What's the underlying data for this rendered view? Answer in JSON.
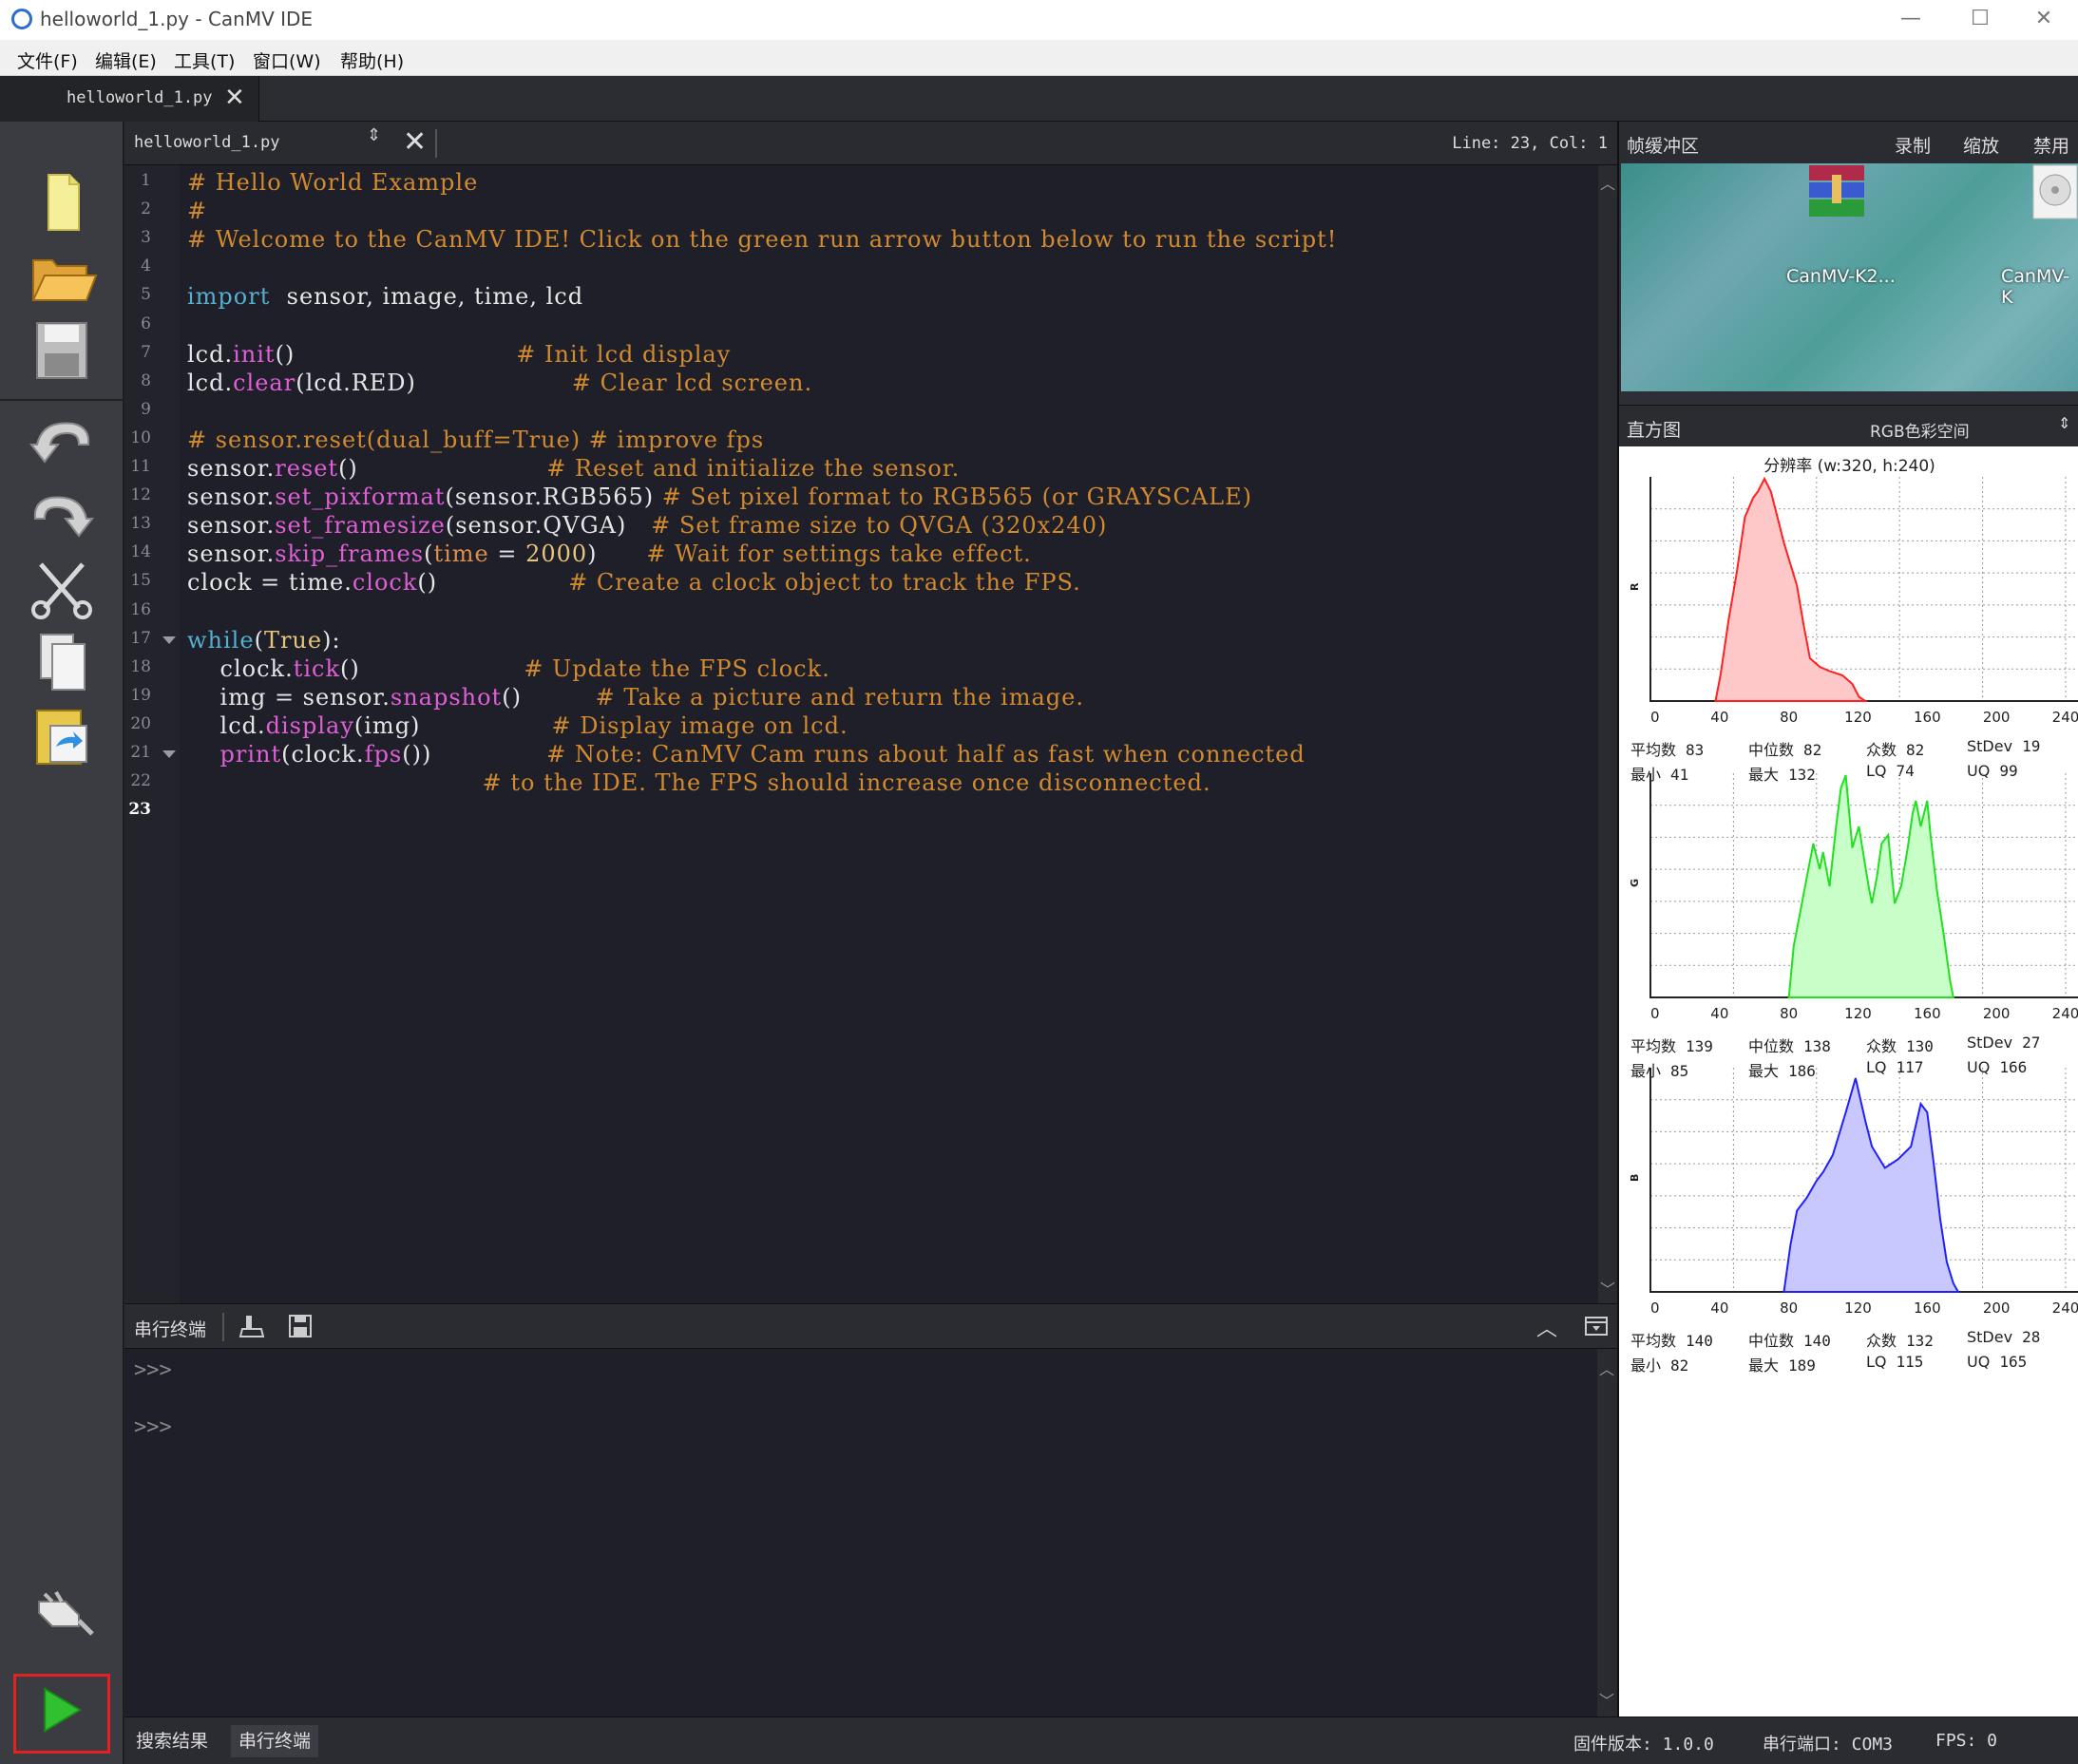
{
  "window": {
    "title": "helloworld_1.py - CanMV IDE",
    "minimize": "—",
    "maximize": "☐",
    "close": "✕"
  },
  "menu": [
    "文件(F)",
    "编辑(E)",
    "工具(T)",
    "窗口(W)",
    "帮助(H)"
  ],
  "file_tab": {
    "label": "helloworld_1.py",
    "close": "✕"
  },
  "toolbar": {
    "icons": [
      "new-file-icon",
      "open-folder-icon",
      "save-icon",
      "undo-icon",
      "redo-icon",
      "cut-icon",
      "copy-icon",
      "paste-icon",
      "connect-icon",
      "run-icon"
    ]
  },
  "editor": {
    "filename": "helloworld_1.py",
    "updown": "⇕",
    "close": "✕",
    "position": "Line: 23, Col: 1",
    "current_line": "23",
    "line_numbers": [
      "1",
      "2",
      "3",
      "4",
      "5",
      "6",
      "7",
      "8",
      "9",
      "10",
      "11",
      "12",
      "13",
      "14",
      "15",
      "16",
      "17",
      "18",
      "19",
      "20",
      "21",
      "22",
      "23"
    ],
    "lines": [
      [
        [
          "c-com",
          "# Hello World Example"
        ]
      ],
      [
        [
          "c-com",
          "#"
        ]
      ],
      [
        [
          "c-com",
          "# Welcome to the CanMV IDE! Click on the green run arrow button below to run the script!"
        ]
      ],
      [],
      [
        [
          "c-kw",
          "import"
        ],
        [
          "",
          "  sensor, image, time, lcd"
        ]
      ],
      [],
      [
        [
          "",
          "lcd."
        ],
        [
          "c-fn",
          "init"
        ],
        [
          "",
          "()                           "
        ],
        [
          "c-com",
          "# Init lcd display"
        ]
      ],
      [
        [
          "",
          "lcd."
        ],
        [
          "c-fn",
          "clear"
        ],
        [
          "",
          "(lcd.RED)                   "
        ],
        [
          "c-com",
          "# Clear lcd screen."
        ]
      ],
      [],
      [
        [
          "c-com",
          "# sensor.reset(dual_buff=True) # improve fps"
        ]
      ],
      [
        [
          "",
          "sensor."
        ],
        [
          "c-fn",
          "reset"
        ],
        [
          "",
          "()                       "
        ],
        [
          "c-com",
          "# Reset and initialize the sensor."
        ]
      ],
      [
        [
          "",
          "sensor."
        ],
        [
          "c-fn",
          "set_pixformat"
        ],
        [
          "",
          "(sensor.RGB565) "
        ],
        [
          "c-com",
          "# Set pixel format to RGB565 (or GRAYSCALE)"
        ]
      ],
      [
        [
          "",
          "sensor."
        ],
        [
          "c-fn",
          "set_framesize"
        ],
        [
          "",
          "(sensor.QVGA)   "
        ],
        [
          "c-com",
          "# Set frame size to QVGA (320x240)"
        ]
      ],
      [
        [
          "",
          "sensor."
        ],
        [
          "c-fn",
          "skip_frames"
        ],
        [
          "",
          "("
        ],
        [
          "c-arg",
          "time"
        ],
        [
          "",
          " = "
        ],
        [
          "c-num",
          "2000"
        ],
        [
          "",
          ")      "
        ],
        [
          "c-com",
          "# Wait for settings take effect."
        ]
      ],
      [
        [
          "",
          "clock = time."
        ],
        [
          "c-fn",
          "clock"
        ],
        [
          "",
          "()                "
        ],
        [
          "c-com",
          "# Create a clock object to track the FPS."
        ]
      ],
      [],
      [
        [
          "c-kw",
          "while"
        ],
        [
          "",
          "("
        ],
        [
          "c-num",
          "True"
        ],
        [
          "",
          "):"
        ]
      ],
      [
        [
          "",
          "    clock."
        ],
        [
          "c-fn",
          "tick"
        ],
        [
          "",
          "()                    "
        ],
        [
          "c-com",
          "# Update the FPS clock."
        ]
      ],
      [
        [
          "",
          "    img = sensor."
        ],
        [
          "c-fn",
          "snapshot"
        ],
        [
          "",
          "()         "
        ],
        [
          "c-com",
          "# Take a picture and return the image."
        ]
      ],
      [
        [
          "",
          "    lcd."
        ],
        [
          "c-fn",
          "display"
        ],
        [
          "",
          "(img)                "
        ],
        [
          "c-com",
          "# Display image on lcd."
        ]
      ],
      [
        [
          "",
          "    "
        ],
        [
          "c-fn",
          "print"
        ],
        [
          "",
          "(clock."
        ],
        [
          "c-fn",
          "fps"
        ],
        [
          "",
          "())              "
        ],
        [
          "c-com",
          "# Note: CanMV Cam runs about half as fast when connected"
        ]
      ],
      [
        [
          "",
          "                                    "
        ],
        [
          "c-com",
          "# to the IDE. The FPS should increase once disconnected."
        ]
      ],
      []
    ]
  },
  "terminal": {
    "title": "串行终端",
    "prompts": [
      ">>>",
      ">>>"
    ]
  },
  "statusbar": {
    "tabs": [
      "搜索结果",
      "串行终端"
    ],
    "firmware": "固件版本: 1.0.0",
    "port": "串行端口: COM3",
    "fps": "FPS: 0"
  },
  "framebuffer": {
    "title": "帧缓冲区",
    "record": "录制",
    "zoom": "缩放",
    "disable": "禁用",
    "desktop_labels": [
      "CanMV-K2...",
      "CanMV-K"
    ]
  },
  "histogram": {
    "title": "直方图",
    "colorspace": "RGB色彩空间",
    "resolution": "分辨率 (w:320, h:240)",
    "x_ticks": [
      "0",
      "40",
      "80",
      "120",
      "160",
      "200",
      "240"
    ],
    "channels": [
      {
        "name": "R",
        "color": "#ffc8c8",
        "stroke": "#ff2020",
        "stats": {
          "mean_label": "平均数",
          "mean": "83",
          "median_label": "中位数",
          "median": "82",
          "mode_label": "众数",
          "mode": "82",
          "stdev_label": "StDev",
          "stdev": "19",
          "min_label": "最小",
          "min": "41",
          "max_label": "最大",
          "max": "132",
          "lq_label": "LQ",
          "lq": "74",
          "uq_label": "UQ",
          "uq": "99"
        },
        "points": [
          [
            40,
            0
          ],
          [
            43,
            12
          ],
          [
            48,
            38
          ],
          [
            53,
            60
          ],
          [
            58,
            86
          ],
          [
            63,
            95
          ],
          [
            66,
            98
          ],
          [
            70,
            104
          ],
          [
            74,
            98
          ],
          [
            78,
            86
          ],
          [
            82,
            74
          ],
          [
            86,
            64
          ],
          [
            90,
            54
          ],
          [
            94,
            36
          ],
          [
            98,
            20
          ],
          [
            104,
            16
          ],
          [
            110,
            14
          ],
          [
            118,
            12
          ],
          [
            124,
            8
          ],
          [
            128,
            2
          ],
          [
            132,
            0
          ]
        ]
      },
      {
        "name": "G",
        "color": "#c8ffc8",
        "stroke": "#20e020",
        "stats": {
          "mean_label": "平均数",
          "mean": "139",
          "median_label": "中位数",
          "median": "138",
          "mode_label": "众数",
          "mode": "130",
          "stdev_label": "StDev",
          "stdev": "27",
          "min_label": "最小",
          "min": "85",
          "max_label": "最大",
          "max": "186",
          "lq_label": "LQ",
          "lq": "117",
          "uq_label": "UQ",
          "uq": "166"
        },
        "points": [
          [
            85,
            0
          ],
          [
            88,
            24
          ],
          [
            92,
            40
          ],
          [
            96,
            56
          ],
          [
            100,
            72
          ],
          [
            104,
            60
          ],
          [
            106,
            68
          ],
          [
            110,
            52
          ],
          [
            114,
            80
          ],
          [
            117,
            98
          ],
          [
            120,
            104
          ],
          [
            124,
            70
          ],
          [
            128,
            80
          ],
          [
            131,
            66
          ],
          [
            134,
            52
          ],
          [
            136,
            44
          ],
          [
            139,
            56
          ],
          [
            142,
            72
          ],
          [
            146,
            76
          ],
          [
            148,
            60
          ],
          [
            150,
            44
          ],
          [
            154,
            52
          ],
          [
            158,
            70
          ],
          [
            161,
            86
          ],
          [
            163,
            92
          ],
          [
            166,
            80
          ],
          [
            168,
            86
          ],
          [
            170,
            92
          ],
          [
            172,
            76
          ],
          [
            176,
            50
          ],
          [
            180,
            30
          ],
          [
            184,
            8
          ],
          [
            186,
            0
          ]
        ]
      },
      {
        "name": "B",
        "color": "#c8c8ff",
        "stroke": "#2020ff",
        "stats": {
          "mean_label": "平均数",
          "mean": "140",
          "median_label": "中位数",
          "median": "140",
          "mode_label": "众数",
          "mode": "132",
          "stdev_label": "StDev",
          "stdev": "28",
          "min_label": "最小",
          "min": "82",
          "max_label": "最大",
          "max": "189",
          "lq_label": "LQ",
          "lq": "115",
          "uq_label": "UQ",
          "uq": "165"
        },
        "points": [
          [
            82,
            0
          ],
          [
            86,
            22
          ],
          [
            90,
            38
          ],
          [
            96,
            44
          ],
          [
            102,
            52
          ],
          [
            106,
            56
          ],
          [
            112,
            64
          ],
          [
            120,
            84
          ],
          [
            126,
            100
          ],
          [
            132,
            80
          ],
          [
            136,
            68
          ],
          [
            144,
            58
          ],
          [
            152,
            62
          ],
          [
            160,
            68
          ],
          [
            166,
            88
          ],
          [
            170,
            84
          ],
          [
            174,
            60
          ],
          [
            178,
            34
          ],
          [
            182,
            14
          ],
          [
            186,
            4
          ],
          [
            189,
            0
          ]
        ]
      }
    ]
  }
}
